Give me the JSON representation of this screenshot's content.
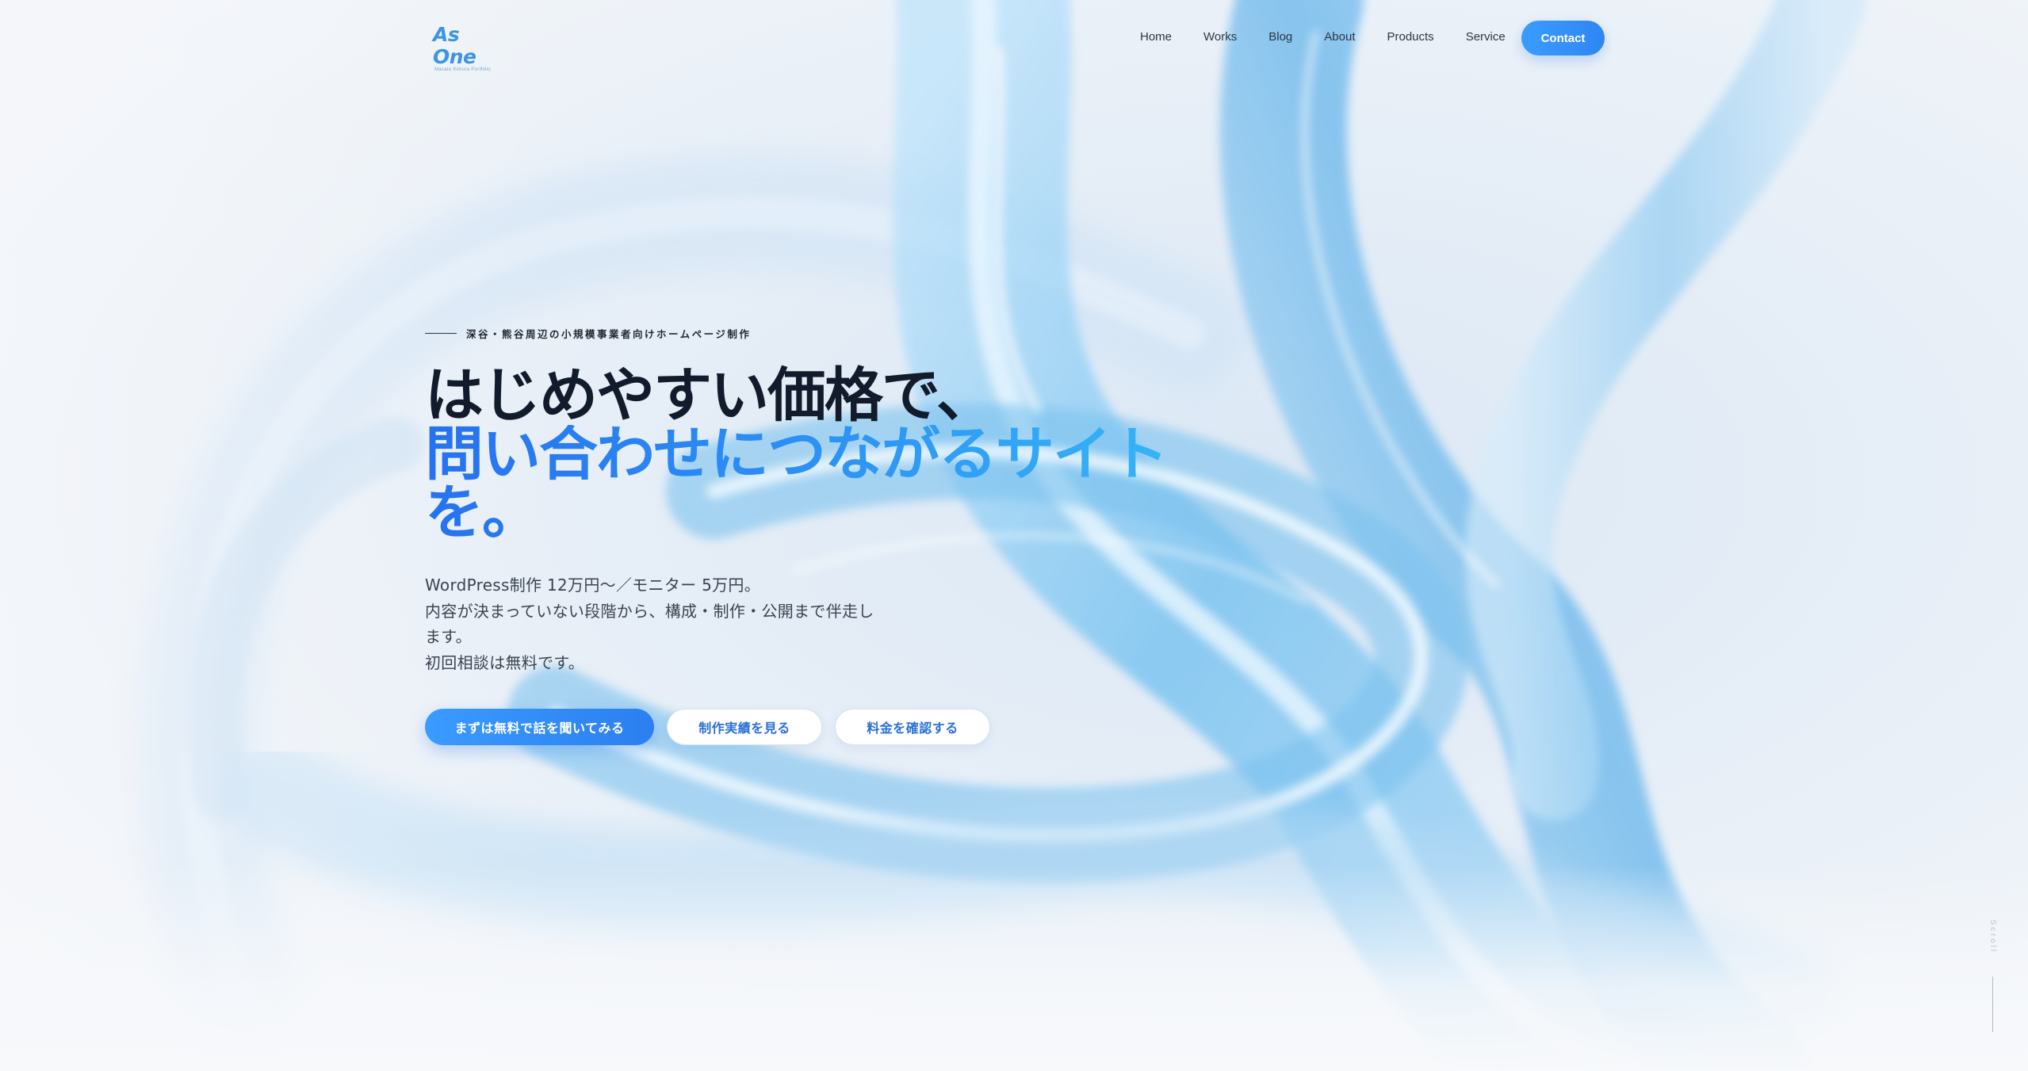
{
  "colors": {
    "accent": "#2f86f2",
    "accent_light": "#36b4f7",
    "headline_dark": "#111b2b",
    "body_text": "#3a4350"
  },
  "header": {
    "logo": {
      "main": "As One",
      "sub": "Masato Kimura Portfolio"
    },
    "nav": [
      "Home",
      "Works",
      "Blog",
      "About",
      "Products",
      "Service"
    ],
    "contact_label": "Contact"
  },
  "hero": {
    "eyebrow": "深谷・熊谷周辺の小規模事業者向けホームページ制作",
    "headline_line1": "はじめやすい価格で、",
    "headline_line2": "問い合わせにつながるサイトを。",
    "description": [
      "WordPress制作 12万円〜／モニター 5万円。",
      "内容が決まっていない段階から、構成・制作・公開まで伴走します。",
      "初回相談は無料です。"
    ],
    "cta": {
      "primary": "まずは無料で話を聞いてみる",
      "works": "制作実績を見る",
      "pricing": "料金を確認する"
    }
  },
  "scroll_label": "Scroll"
}
